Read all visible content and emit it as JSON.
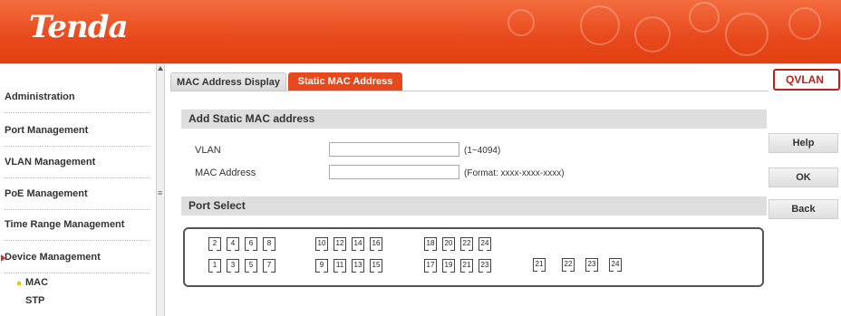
{
  "brand": {
    "logo_text": "Tenda",
    "accent_color": "#e8491c",
    "highlight_color": "#c0201a"
  },
  "sidebar": {
    "items": [
      {
        "label": "Administration"
      },
      {
        "label": "Port Management"
      },
      {
        "label": "VLAN Management"
      },
      {
        "label": "PoE Management"
      },
      {
        "label": "Time Range Management"
      },
      {
        "label": "Device Management"
      }
    ],
    "subitems": [
      {
        "label": "MAC"
      },
      {
        "label": "STP"
      }
    ]
  },
  "tabs": [
    {
      "label": "MAC Address Display",
      "active": false
    },
    {
      "label": "Static MAC Address",
      "active": true
    }
  ],
  "qvlan_label": "QVLAN",
  "form": {
    "section_title": "Add Static MAC address",
    "vlan_label": "VLAN",
    "vlan_value": "",
    "vlan_hint": "(1~4094)",
    "mac_label": "MAC Address",
    "mac_value": "",
    "mac_hint": "(Format: xxxx-xxxx-xxxx)"
  },
  "port_select": {
    "title": "Port Select",
    "top_row": [
      "2",
      "4",
      "6",
      "8",
      "10",
      "12",
      "14",
      "16",
      "18",
      "20",
      "22",
      "24"
    ],
    "bottom_row": [
      "1",
      "3",
      "5",
      "7",
      "9",
      "11",
      "13",
      "15",
      "17",
      "19",
      "21",
      "23"
    ],
    "extra_row": [
      "21",
      "22",
      "23",
      "24"
    ]
  },
  "buttons": {
    "help": "Help",
    "ok": "OK",
    "back": "Back"
  }
}
